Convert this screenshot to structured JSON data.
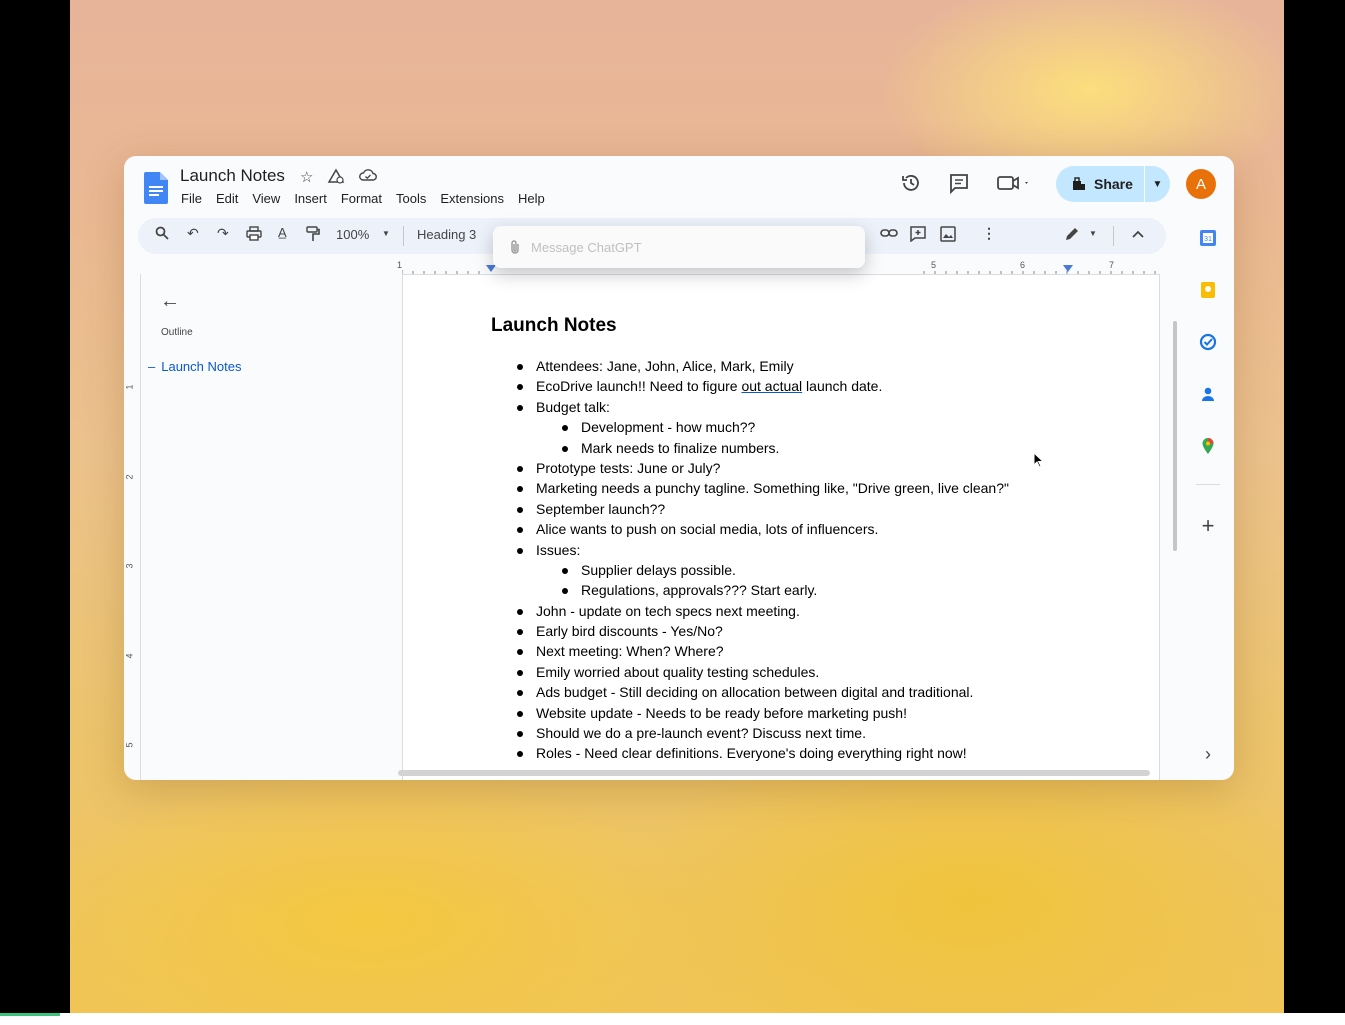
{
  "document": {
    "title": "Launch Notes",
    "menu": [
      "File",
      "Edit",
      "View",
      "Insert",
      "Format",
      "Tools",
      "Extensions",
      "Help"
    ]
  },
  "header": {
    "share_label": "Share",
    "avatar_letter": "A"
  },
  "toolbar": {
    "zoom": "100%",
    "style": "Heading 3"
  },
  "chatgpt_bar": {
    "placeholder": "Message ChatGPT"
  },
  "ruler": {
    "h_numbers": [
      "1",
      "5",
      "6",
      "7"
    ],
    "v_numbers": [
      "1",
      "2",
      "3",
      "4",
      "5"
    ]
  },
  "outline": {
    "label": "Outline",
    "items": [
      "Launch Notes"
    ]
  },
  "body": {
    "heading": "Launch Notes",
    "bullets": [
      {
        "level": 1,
        "text": "Attendees: Jane, John, Alice, Mark, Emily"
      },
      {
        "level": 1,
        "text_before": "EcoDrive launch!! Need to figure ",
        "text_underlined": "out actual",
        "text_after": " launch date."
      },
      {
        "level": 1,
        "text": "Budget talk:"
      },
      {
        "level": 2,
        "text": "Development - how much??"
      },
      {
        "level": 2,
        "text": "Mark needs to finalize numbers."
      },
      {
        "level": 1,
        "text": "Prototype tests: June or July?"
      },
      {
        "level": 1,
        "text": "Marketing needs a punchy tagline. Something like, \"Drive green, live clean?\""
      },
      {
        "level": 1,
        "text": "September launch??"
      },
      {
        "level": 1,
        "text": "Alice wants to push on social media, lots of influencers."
      },
      {
        "level": 1,
        "text": "Issues:"
      },
      {
        "level": 2,
        "text": "Supplier delays possible."
      },
      {
        "level": 2,
        "text": "Regulations, approvals??? Start early."
      },
      {
        "level": 1,
        "text": "John - update on tech specs next meeting."
      },
      {
        "level": 1,
        "text": "Early bird discounts - Yes/No?"
      },
      {
        "level": 1,
        "text": "Next meeting: When? Where?"
      },
      {
        "level": 1,
        "text": "Emily worried about quality testing schedules."
      },
      {
        "level": 1,
        "text": "Ads budget - Still deciding on allocation between digital and traditional."
      },
      {
        "level": 1,
        "text": "Website update - Needs to be ready before marketing push!"
      },
      {
        "level": 1,
        "text": "Should we do a pre-launch event? Discuss next time."
      },
      {
        "level": 1,
        "text": "Roles - Need clear definitions. Everyone's doing everything right now!"
      }
    ]
  },
  "side_panel_icons": [
    "calendar-icon",
    "keep-icon",
    "tasks-icon",
    "contacts-icon",
    "maps-icon",
    "add-icon",
    "chevron-right-icon"
  ],
  "colors": {
    "accent": "#0b57d0",
    "share_bg": "#c2e7ff",
    "avatar_bg": "#e8710a",
    "toolbar_bg": "#edf2fa"
  }
}
